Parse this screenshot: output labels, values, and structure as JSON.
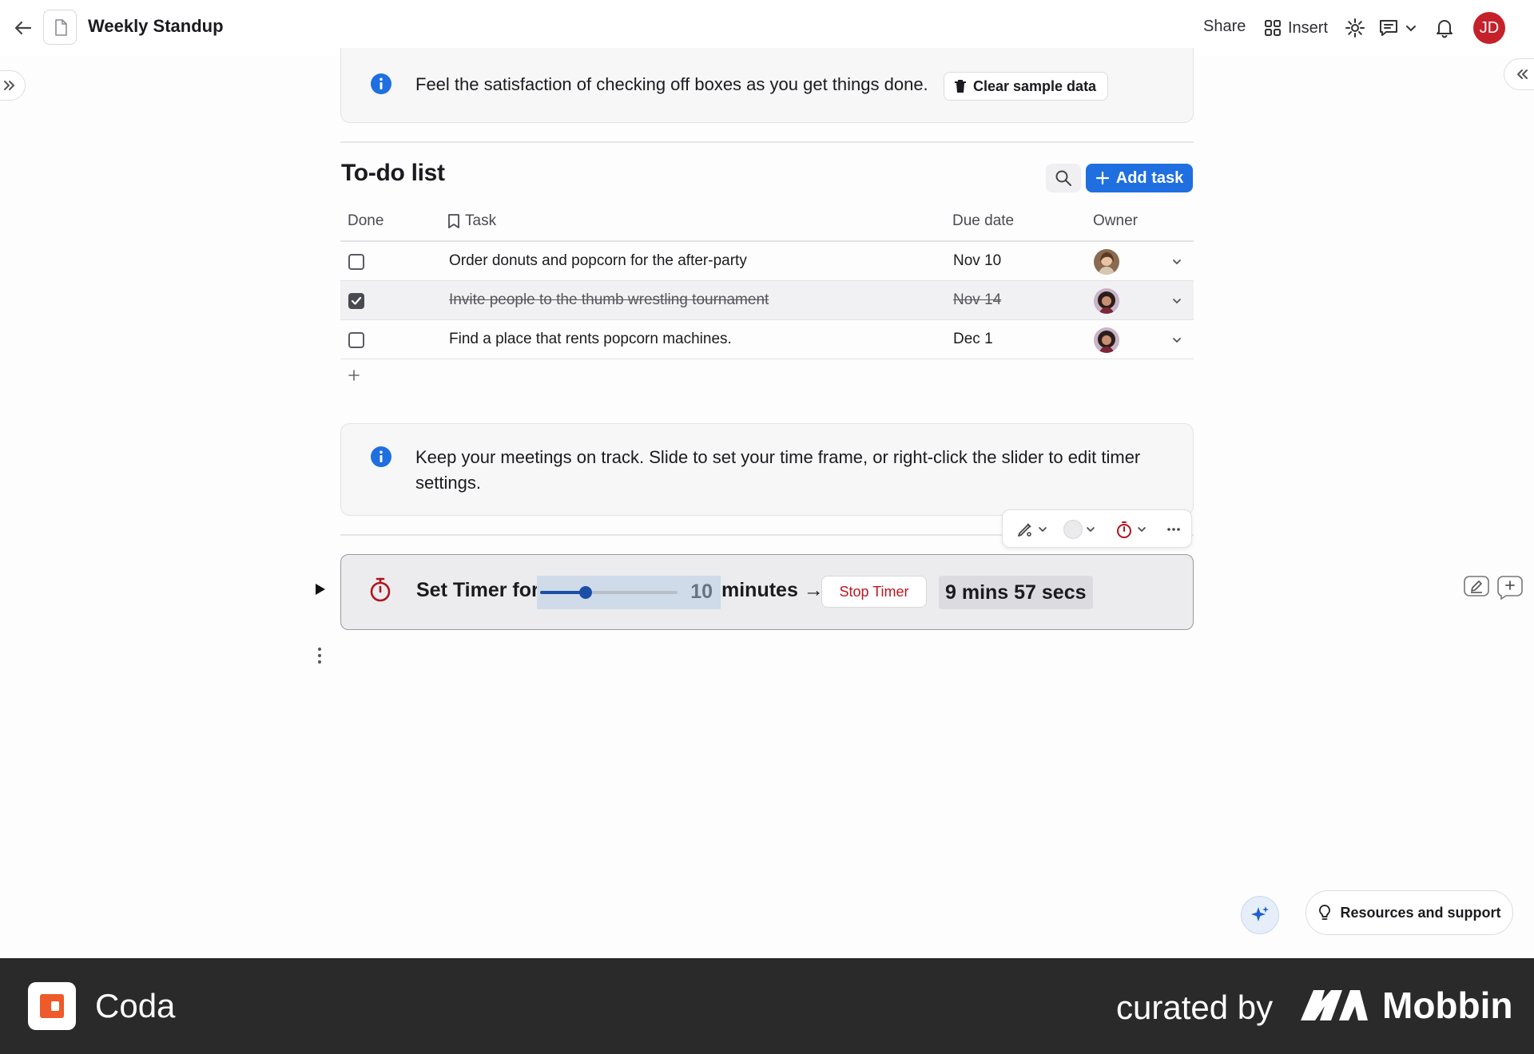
{
  "topbar": {
    "doc_title": "Weekly Standup",
    "share_label": "Share",
    "insert_label": "Insert",
    "avatar_initials": "JD",
    "avatar_color": "#c5212b"
  },
  "callout_sample": {
    "text": "Feel the satisfaction of checking off boxes as you get things done.",
    "button_label": "Clear sample data"
  },
  "todo": {
    "title": "To-do list",
    "add_button_label": "Add task",
    "columns": [
      "Done",
      "Task",
      "Due date",
      "Owner"
    ],
    "rows": [
      {
        "done": false,
        "task": "Order donuts and popcorn for the after-party",
        "due": "Nov 10",
        "owner": "avatar-woman-brown-hair"
      },
      {
        "done": true,
        "task": "Invite people to the thumb wrestling tournament",
        "due": "Nov 14",
        "owner": "avatar-woman-curly-hair"
      },
      {
        "done": false,
        "task": "Find a place that rents popcorn machines.",
        "due": "Dec 1",
        "owner": "avatar-woman-curly-hair"
      }
    ]
  },
  "callout_timer": {
    "text": "Keep your meetings on track. Slide to set your time frame, or right-click the slider to edit timer settings."
  },
  "timer": {
    "label": "Set Timer for",
    "slider_value": "10",
    "slider_fraction": 0.33,
    "unit_label": "minutes →",
    "stop_label": "Stop Timer",
    "remaining": "9 mins 57 secs"
  },
  "resources_label": "Resources and support",
  "footer": {
    "app_name": "Coda",
    "curated_by": "curated by",
    "brand": "Mobbin"
  },
  "colors": {
    "accent_blue": "#1f6fe0",
    "stop_red": "#c0141f",
    "coda_orange": "#ee5a29"
  }
}
